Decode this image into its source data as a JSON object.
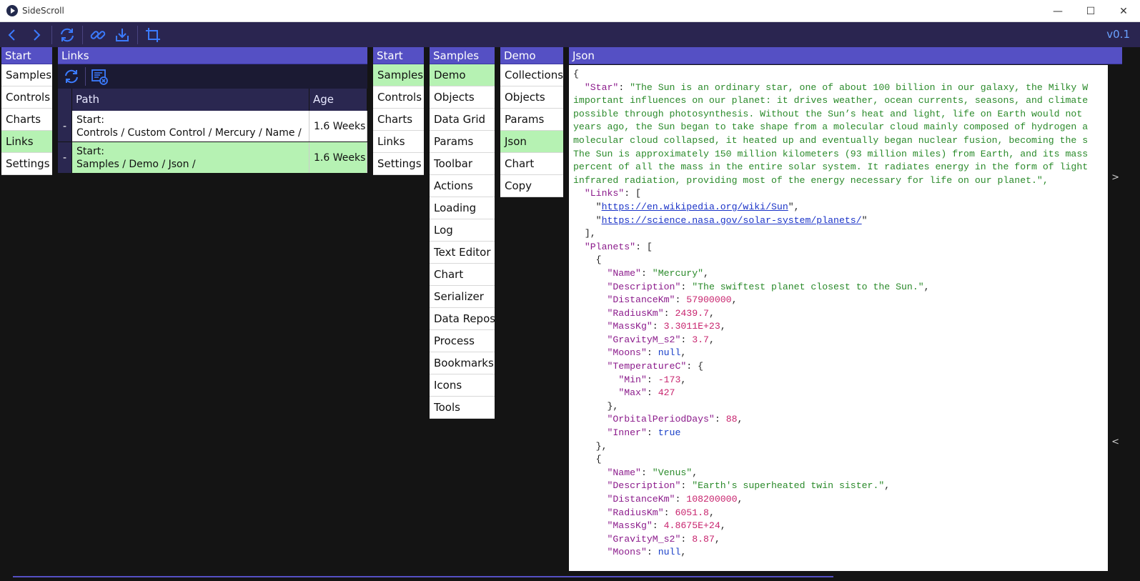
{
  "window": {
    "title": "SideScroll",
    "minimize": "—",
    "maximize": "☐",
    "close": "✕"
  },
  "toolbar": {
    "version": "v0.1",
    "accent_color": "#3b7bff"
  },
  "panels": {
    "start_left": {
      "title": "Start",
      "items": [
        "Samples",
        "Controls",
        "Charts",
        "Links",
        "Settings"
      ],
      "selected": "Links"
    },
    "links": {
      "title": "Links",
      "columns": [
        "Path",
        "Age"
      ],
      "rows": [
        {
          "dash": "-",
          "line1": "Start:",
          "line2": "Controls / Custom Control / Mercury / Name /",
          "age": "1.6 Weeks"
        },
        {
          "dash": "-",
          "line1": "Start:",
          "line2": "Samples / Demo / Json /",
          "age": "1.6 Weeks"
        }
      ]
    },
    "start_right": {
      "title": "Start",
      "items": [
        "Samples",
        "Controls",
        "Charts",
        "Links",
        "Settings"
      ],
      "selected": "Samples"
    },
    "samples": {
      "title": "Samples",
      "items": [
        "Demo",
        "Objects",
        "Data Grid",
        "Params",
        "Toolbar",
        "Actions",
        "Loading",
        "Log",
        "Text Editor",
        "Chart",
        "Serializer",
        "Data Repos",
        "Process",
        "Bookmarks",
        "Icons",
        "Tools"
      ],
      "selected": "Demo"
    },
    "demo": {
      "title": "Demo",
      "items": [
        "Collections",
        "Objects",
        "Params",
        "Json",
        "Chart",
        "Copy"
      ],
      "selected": "Json"
    },
    "json": {
      "title": "Json",
      "scroll_right": ">",
      "scroll_left": "<",
      "star_lines": [
        "\"The Sun is an ordinary star, one of about 100 billion in our galaxy, the Milky W",
        "important influences on our planet: it drives weather, ocean currents, seasons, and climate",
        "possible through photosynthesis. Without the Sun’s heat and light, life on Earth would not",
        "years ago, the Sun began to take shape from a molecular cloud mainly composed of hydrogen a",
        "molecular cloud collapsed, it heated up and eventually began nuclear fusion, becoming the s",
        "The Sun is approximately 150 million kilometers (93 million miles) from Earth, and its mass",
        "percent of all the mass in the entire solar system. It radiates energy in the form of light",
        "infrared radiation, providing most of the energy necessary for life on our planet.\","
      ],
      "links": [
        "https://en.wikipedia.org/wiki/Sun",
        "https://science.nasa.gov/solar-system/planets/"
      ],
      "planets": [
        {
          "Name": "\"Mercury\"",
          "Description": "\"The swiftest planet closest to the Sun.\"",
          "DistanceKm": "57900000",
          "RadiusKm": "2439.7",
          "MassKg": "3.3011E+23",
          "GravityM_s2": "3.7",
          "Moons": "null",
          "Min": "-173",
          "Max": "427",
          "OrbitalPeriodDays": "88",
          "Inner": "true"
        },
        {
          "Name": "\"Venus\"",
          "Description": "\"Earth's superheated twin sister.\"",
          "DistanceKm": "108200000",
          "RadiusKm": "6051.8",
          "MassKg": "4.8675E+24",
          "GravityM_s2": "8.87",
          "Moons": "null"
        }
      ]
    }
  }
}
